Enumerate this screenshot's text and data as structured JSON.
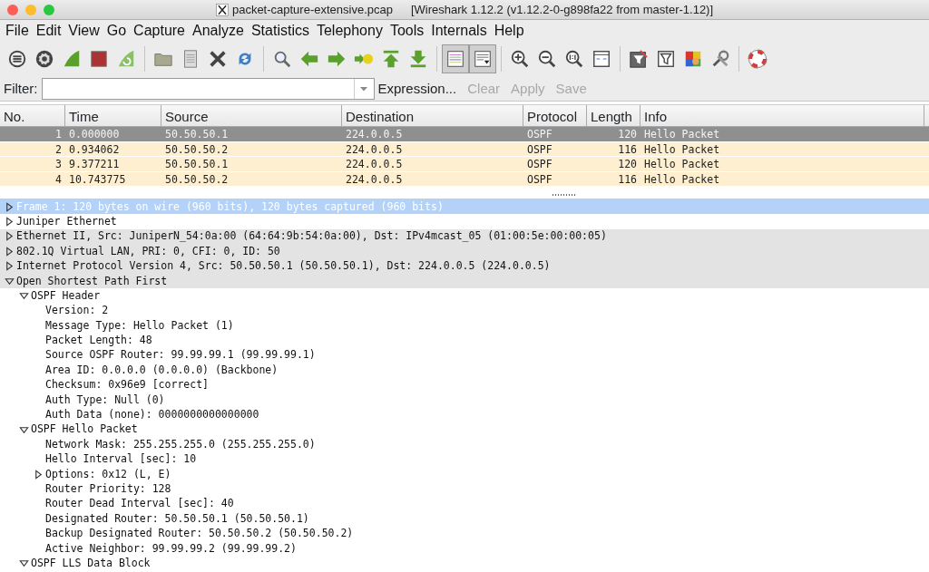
{
  "window": {
    "title": "packet-capture-extensive.pcap",
    "subtitle": "[Wireshark 1.12.2  (v1.12.2-0-g898fa22 from master-1.12)]"
  },
  "menu": [
    "File",
    "Edit",
    "View",
    "Go",
    "Capture",
    "Analyze",
    "Statistics",
    "Telephony",
    "Tools",
    "Internals",
    "Help"
  ],
  "toolbar": {
    "colorize_pressed": true,
    "autoscroll_pressed": true
  },
  "filter": {
    "label": "Filter:",
    "buttons": [
      {
        "label": "Expression...",
        "disabled": false
      },
      {
        "label": "Clear",
        "disabled": true
      },
      {
        "label": "Apply",
        "disabled": true
      },
      {
        "label": "Save",
        "disabled": true
      }
    ]
  },
  "packets": {
    "columns": [
      "No.",
      "Time",
      "Source",
      "Destination",
      "Protocol",
      "Length",
      "Info"
    ],
    "rows": [
      {
        "cells": [
          "1",
          "0.000000",
          "50.50.50.1",
          "224.0.0.5",
          "OSPF",
          "120",
          "Hello Packet"
        ],
        "selected": true
      },
      {
        "cells": [
          "2",
          "0.934062",
          "50.50.50.2",
          "224.0.0.5",
          "OSPF",
          "116",
          "Hello Packet"
        ],
        "selected": false
      },
      {
        "cells": [
          "3",
          "9.377211",
          "50.50.50.1",
          "224.0.0.5",
          "OSPF",
          "120",
          "Hello Packet"
        ],
        "selected": false
      },
      {
        "cells": [
          "4",
          "10.743775",
          "50.50.50.2",
          "224.0.0.5",
          "OSPF",
          "116",
          "Hello Packet"
        ],
        "selected": false
      }
    ]
  },
  "details": [
    {
      "text": "Frame 1: 120 bytes on wire (960 bits), 120 bytes captured (960 bits)",
      "expanded": false,
      "selected": true,
      "shaded": false
    },
    {
      "text": "Juniper Ethernet",
      "expanded": false,
      "selected": false,
      "shaded": false
    },
    {
      "text": "Ethernet II, Src: JuniperN_54:0a:00 (64:64:9b:54:0a:00), Dst: IPv4mcast_05 (01:00:5e:00:00:05)",
      "expanded": false,
      "selected": false,
      "shaded": true
    },
    {
      "text": "802.1Q Virtual LAN, PRI: 0, CFI: 0, ID: 50",
      "expanded": false,
      "selected": false,
      "shaded": true
    },
    {
      "text": "Internet Protocol Version 4, Src: 50.50.50.1 (50.50.50.1), Dst: 224.0.0.5 (224.0.0.5)",
      "expanded": false,
      "selected": false,
      "shaded": true
    },
    {
      "text": "Open Shortest Path First",
      "expanded": true,
      "selected": false,
      "shaded": true,
      "children": [
        {
          "text": "OSPF Header",
          "expanded": true,
          "selected": false,
          "shaded": false,
          "children": [
            {
              "text": "Version: 2",
              "selected": false,
              "shaded": false
            },
            {
              "text": "Message Type: Hello Packet (1)",
              "selected": false,
              "shaded": false
            },
            {
              "text": "Packet Length: 48",
              "selected": false,
              "shaded": false
            },
            {
              "text": "Source OSPF Router: 99.99.99.1 (99.99.99.1)",
              "selected": false,
              "shaded": false
            },
            {
              "text": "Area ID: 0.0.0.0 (0.0.0.0) (Backbone)",
              "selected": false,
              "shaded": false
            },
            {
              "text": "Checksum: 0x96e9 [correct]",
              "selected": false,
              "shaded": false
            },
            {
              "text": "Auth Type: Null (0)",
              "selected": false,
              "shaded": false
            },
            {
              "text": "Auth Data (none): 0000000000000000",
              "selected": false,
              "shaded": false
            }
          ]
        },
        {
          "text": "OSPF Hello Packet",
          "expanded": true,
          "selected": false,
          "shaded": false,
          "children": [
            {
              "text": "Network Mask: 255.255.255.0 (255.255.255.0)",
              "selected": false,
              "shaded": false
            },
            {
              "text": "Hello Interval [sec]: 10",
              "selected": false,
              "shaded": false
            },
            {
              "text": "Options: 0x12 (L, E)",
              "expanded": false,
              "selected": false,
              "shaded": false
            },
            {
              "text": "Router Priority: 128",
              "selected": false,
              "shaded": false
            },
            {
              "text": "Router Dead Interval [sec]: 40",
              "selected": false,
              "shaded": false
            },
            {
              "text": "Designated Router: 50.50.50.1 (50.50.50.1)",
              "selected": false,
              "shaded": false
            },
            {
              "text": "Backup Designated Router: 50.50.50.2 (50.50.50.2)",
              "selected": false,
              "shaded": false
            },
            {
              "text": "Active Neighbor: 99.99.99.2 (99.99.99.2)",
              "selected": false,
              "shaded": false
            }
          ]
        },
        {
          "text": "OSPF LLS Data Block",
          "expanded": true,
          "selected": false,
          "shaded": false
        }
      ]
    }
  ]
}
